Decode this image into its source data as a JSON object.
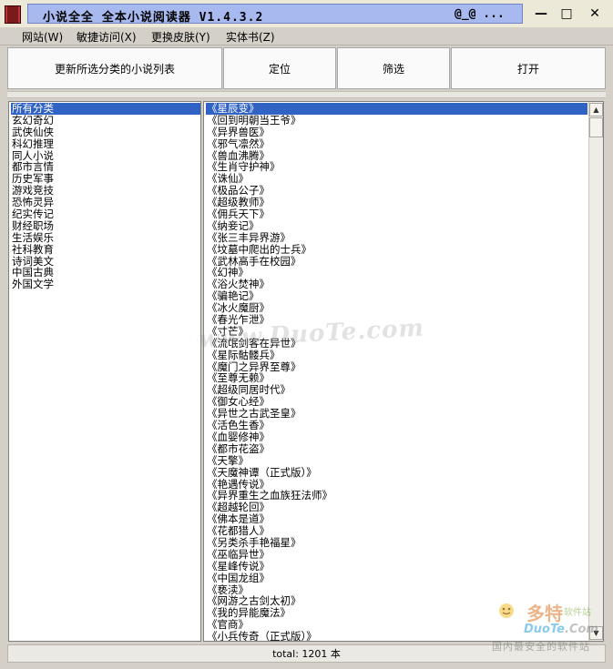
{
  "window": {
    "title": "小说全全  全本小说阅读器  V1.4.3.2",
    "title_right": "@_@   ...",
    "controls": {
      "minimize": "—",
      "maximize": "□",
      "close": "✕"
    }
  },
  "menu": [
    "网站(W)",
    "敏捷访问(X)",
    "更换皮肤(Y)",
    "实体书(Z)"
  ],
  "toolbar": {
    "refresh_label": "更新所选分类的小说列表",
    "locate_label": "定位",
    "filter_label": "筛选",
    "open_label": "打开"
  },
  "categories": {
    "selected_index": 0,
    "items": [
      "所有分类",
      "玄幻奇幻",
      "武侠仙侠",
      "科幻推理",
      "同人小说",
      "都市言情",
      "历史军事",
      "游戏竞技",
      "恐怖灵异",
      "纪实传记",
      "财经职场",
      "生活娱乐",
      "社科教育",
      "诗词美文",
      "中国古典",
      "外国文学"
    ]
  },
  "novels": {
    "selected_index": 0,
    "items": [
      "《星辰变》",
      "《回到明朝当王爷》",
      "《异界兽医》",
      "《邪气凛然》",
      "《兽血沸腾》",
      "《生肖守护神》",
      "《诛仙》",
      "《极品公子》",
      "《超级教师》",
      "《佣兵天下》",
      "《纳妾记》",
      "《张三丰异界游》",
      "《坟墓中爬出的士兵》",
      "《武林高手在校园》",
      "《幻神》",
      "《浴火焚神》",
      "《骗艳记》",
      "《冰火魔厨》",
      "《春光乍泄》",
      "《寸芒》",
      "《流氓剑客在异世》",
      "《星际骷髅兵》",
      "《魔门之异界至尊》",
      "《至尊无赖》",
      "《超级同居时代》",
      "《御女心经》",
      "《异世之古武圣皇》",
      "《活色生香》",
      "《血婴修神》",
      "《都市花盗》",
      "《天擎》",
      "《天魔神谭（正式版）》",
      "《艳遇传说》",
      "《异界重生之血族狂法师》",
      "《超越轮回》",
      "《佛本是道》",
      "《花都猎人》",
      "《另类杀手艳福星》",
      "《巫临异世》",
      "《星峰传说》",
      "《中国龙组》",
      "《亵渎》",
      "《网游之古剑太初》",
      "《我的异能魔法》",
      "《官商》",
      "《小兵传奇（正式版）》"
    ]
  },
  "status": {
    "total_text": "total: 1201 本"
  },
  "watermark": {
    "center": "www.DuoTe.com",
    "logo_cn": "多特",
    "logo_small": "软件站",
    "logo_en": "DuoTe",
    "logo_en2": ".Com",
    "logo_sub": "国内最安全的软件站"
  }
}
